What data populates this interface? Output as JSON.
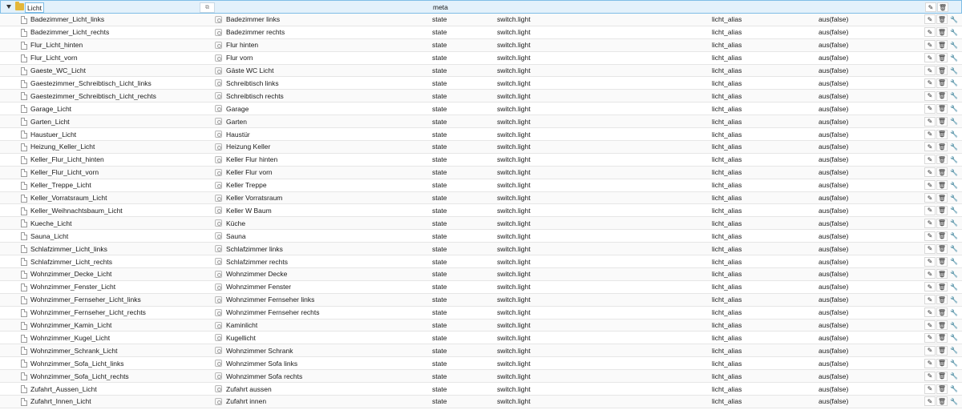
{
  "header": {
    "folder_label": "Licht",
    "type": "meta",
    "copy_icon": "copy-icon",
    "expand_icon": "expand-triangle-icon",
    "folder_icon": "folder-icon"
  },
  "actions": {
    "edit_icon": "pencil-icon",
    "delete_icon": "trash-icon",
    "settings_icon": "wrench-icon"
  },
  "rows": [
    {
      "id": "Badezimmer_Licht_links",
      "name": "Badezimmer links",
      "type": "state",
      "role": "switch.light",
      "alias": "licht_alias",
      "value": "aus(false)"
    },
    {
      "id": "Badezimmer_Licht_rechts",
      "name": "Badezimmer rechts",
      "type": "state",
      "role": "switch.light",
      "alias": "licht_alias",
      "value": "aus(false)"
    },
    {
      "id": "Flur_Licht_hinten",
      "name": "Flur hinten",
      "type": "state",
      "role": "switch.light",
      "alias": "licht_alias",
      "value": "aus(false)"
    },
    {
      "id": "Flur_Licht_vorn",
      "name": "Flur vorn",
      "type": "state",
      "role": "switch.light",
      "alias": "licht_alias",
      "value": "aus(false)"
    },
    {
      "id": "Gaeste_WC_Licht",
      "name": "Gäste WC Licht",
      "type": "state",
      "role": "switch.light",
      "alias": "licht_alias",
      "value": "aus(false)"
    },
    {
      "id": "Gaestezimmer_Schreibtisch_Licht_links",
      "name": "Schreibtisch links",
      "type": "state",
      "role": "switch.light",
      "alias": "licht_alias",
      "value": "aus(false)"
    },
    {
      "id": "Gaestezimmer_Schreibtisch_Licht_rechts",
      "name": "Schreibtisch rechts",
      "type": "state",
      "role": "switch.light",
      "alias": "licht_alias",
      "value": "aus(false)"
    },
    {
      "id": "Garage_Licht",
      "name": "Garage",
      "type": "state",
      "role": "switch.light",
      "alias": "licht_alias",
      "value": "aus(false)"
    },
    {
      "id": "Garten_Licht",
      "name": "Garten",
      "type": "state",
      "role": "switch.light",
      "alias": "licht_alias",
      "value": "aus(false)"
    },
    {
      "id": "Haustuer_Licht",
      "name": "Haustür",
      "type": "state",
      "role": "switch.light",
      "alias": "licht_alias",
      "value": "aus(false)"
    },
    {
      "id": "Heizung_Keller_Licht",
      "name": "Heizung Keller",
      "type": "state",
      "role": "switch.light",
      "alias": "licht_alias",
      "value": "aus(false)"
    },
    {
      "id": "Keller_Flur_Licht_hinten",
      "name": "Keller Flur hinten",
      "type": "state",
      "role": "switch.light",
      "alias": "licht_alias",
      "value": "aus(false)"
    },
    {
      "id": "Keller_Flur_Licht_vorn",
      "name": "Keller Flur vorn",
      "type": "state",
      "role": "switch.light",
      "alias": "licht_alias",
      "value": "aus(false)"
    },
    {
      "id": "Keller_Treppe_Licht",
      "name": "Keller Treppe",
      "type": "state",
      "role": "switch.light",
      "alias": "licht_alias",
      "value": "aus(false)"
    },
    {
      "id": "Keller_Vorratsraum_Licht",
      "name": "Keller Vorratsraum",
      "type": "state",
      "role": "switch.light",
      "alias": "licht_alias",
      "value": "aus(false)"
    },
    {
      "id": "Keller_Weihnachtsbaum_Licht",
      "name": "Keller W Baum",
      "type": "state",
      "role": "switch.light",
      "alias": "licht_alias",
      "value": "aus(false)"
    },
    {
      "id": "Kueche_Licht",
      "name": "Küche",
      "type": "state",
      "role": "switch.light",
      "alias": "licht_alias",
      "value": "aus(false)"
    },
    {
      "id": "Sauna_Licht",
      "name": "Sauna",
      "type": "state",
      "role": "switch.light",
      "alias": "licht_alias",
      "value": "aus(false)"
    },
    {
      "id": "Schlafzimmer_Licht_links",
      "name": "Schlafzimmer links",
      "type": "state",
      "role": "switch.light",
      "alias": "licht_alias",
      "value": "aus(false)"
    },
    {
      "id": "Schlafzimmer_Licht_rechts",
      "name": "Schlafzimmer rechts",
      "type": "state",
      "role": "switch.light",
      "alias": "licht_alias",
      "value": "aus(false)"
    },
    {
      "id": "Wohnzimmer_Decke_Licht",
      "name": "Wohnzimmer Decke",
      "type": "state",
      "role": "switch.light",
      "alias": "licht_alias",
      "value": "aus(false)"
    },
    {
      "id": "Wohnzimmer_Fenster_Licht",
      "name": "Wohnzimmer Fenster",
      "type": "state",
      "role": "switch.light",
      "alias": "licht_alias",
      "value": "aus(false)"
    },
    {
      "id": "Wohnzimmer_Fernseher_Licht_links",
      "name": "Wohnzimmer Fernseher links",
      "type": "state",
      "role": "switch.light",
      "alias": "licht_alias",
      "value": "aus(false)"
    },
    {
      "id": "Wohnzimmer_Fernseher_Licht_rechts",
      "name": "Wohnzimmer Fernseher rechts",
      "type": "state",
      "role": "switch.light",
      "alias": "licht_alias",
      "value": "aus(false)"
    },
    {
      "id": "Wohnzimmer_Kamin_Licht",
      "name": "Kaminlicht",
      "type": "state",
      "role": "switch.light",
      "alias": "licht_alias",
      "value": "aus(false)"
    },
    {
      "id": "Wohnzimmer_Kugel_Licht",
      "name": "Kugellicht",
      "type": "state",
      "role": "switch.light",
      "alias": "licht_alias",
      "value": "aus(false)"
    },
    {
      "id": "Wohnzimmer_Schrank_Licht",
      "name": "Wohnzimmer Schrank",
      "type": "state",
      "role": "switch.light",
      "alias": "licht_alias",
      "value": "aus(false)"
    },
    {
      "id": "Wohnzimmer_Sofa_Licht_links",
      "name": "Wohnzimmer Sofa links",
      "type": "state",
      "role": "switch.light",
      "alias": "licht_alias",
      "value": "aus(false)"
    },
    {
      "id": "Wohnzimmer_Sofa_Licht_rechts",
      "name": "Wohnzimmer Sofa rechts",
      "type": "state",
      "role": "switch.light",
      "alias": "licht_alias",
      "value": "aus(false)"
    },
    {
      "id": "Zufahrt_Aussen_Licht",
      "name": "Zufahrt aussen",
      "type": "state",
      "role": "switch.light",
      "alias": "licht_alias",
      "value": "aus(false)"
    },
    {
      "id": "Zufahrt_Innen_Licht",
      "name": "Zufahrt innen",
      "type": "state",
      "role": "switch.light",
      "alias": "licht_alias",
      "value": "aus(false)"
    }
  ]
}
